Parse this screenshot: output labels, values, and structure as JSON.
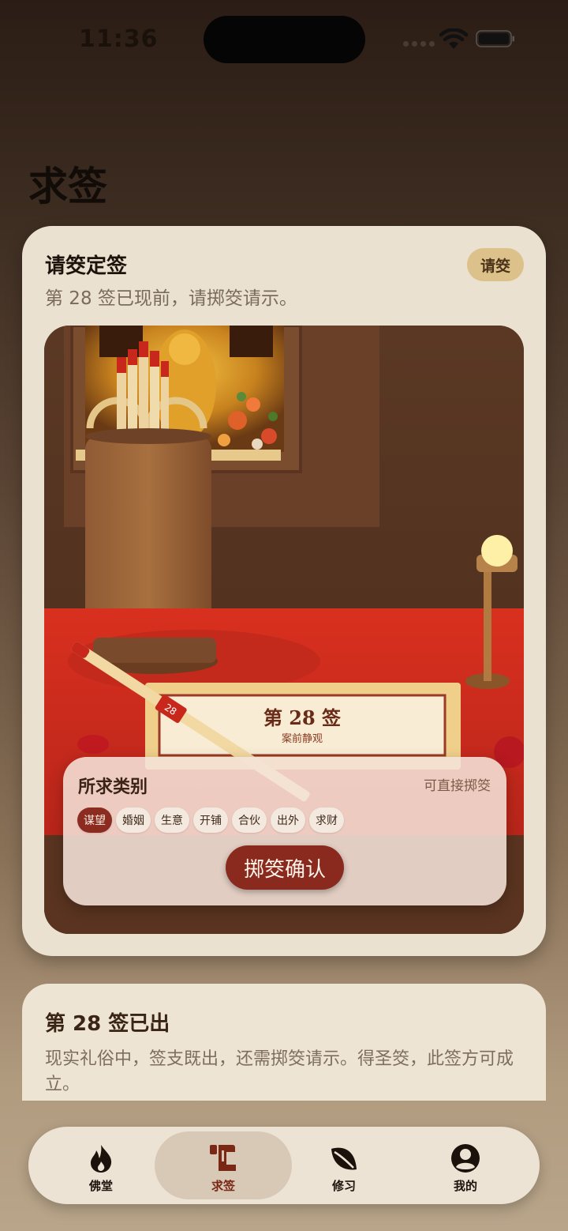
{
  "status_bar": {
    "time": "11:36"
  },
  "page": {
    "title": "求签"
  },
  "main_card": {
    "title": "请筊定签",
    "subtitle": "第 28 签已现前，请掷筊请示。",
    "badge": "请筊",
    "scene": {
      "stick_tag": "28",
      "plaque_title": "第 28 签",
      "plaque_subtitle": "案前静观"
    },
    "category_panel": {
      "title": "所求类别",
      "hint": "可直接掷筊",
      "chips": [
        "谋望",
        "婚姻",
        "生意",
        "开铺",
        "合伙",
        "出外",
        "求财"
      ],
      "selected": "谋望",
      "confirm_label": "掷筊确认"
    }
  },
  "info_card": {
    "title": "第 28 签已出",
    "body": "现实礼俗中，签支既出，还需掷筊请示。得圣筊，此签方可成立。"
  },
  "tab_bar": {
    "active": "求签",
    "tabs": [
      {
        "label": "佛堂",
        "icon": "flame-icon"
      },
      {
        "label": "求签",
        "icon": "scroll-icon"
      },
      {
        "label": "修习",
        "icon": "leaf-icon"
      },
      {
        "label": "我的",
        "icon": "person-icon"
      }
    ]
  },
  "colors": {
    "accent": "#8a2a1e",
    "card": "#ebe1d1",
    "badge": "#dcc18a"
  }
}
